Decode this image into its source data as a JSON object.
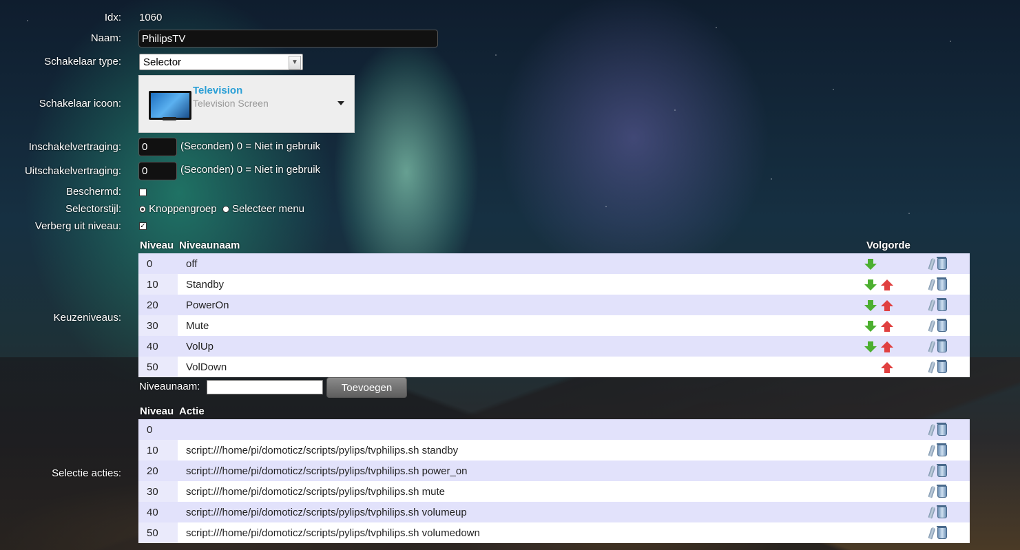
{
  "form": {
    "idx_label": "Idx:",
    "idx_value": "1060",
    "name_label": "Naam:",
    "name_value": "PhilipsTV",
    "switch_type_label": "Schakelaar type:",
    "switch_type_value": "Selector",
    "switch_icon_label": "Schakelaar icoon:",
    "icon_title": "Television",
    "icon_subtitle": "Television Screen",
    "on_delay_label": "Inschakelvertraging:",
    "on_delay_value": "0",
    "off_delay_label": "Uitschakelvertraging:",
    "off_delay_value": "0",
    "delay_hint": "(Seconden) 0 = Niet in gebruik",
    "protected_label": "Beschermd:",
    "protected_checked": false,
    "selector_style_label": "Selectorstijl:",
    "style_option_buttons": "Knoppengroep",
    "style_option_menu": "Selecteer menu",
    "style_selected": "Knoppengroep",
    "hide_off_label": "Verberg uit niveau:",
    "hide_off_checked": true,
    "check_mark": "✓"
  },
  "levels": {
    "section_label": "Keuzeniveaus:",
    "col_level": "Niveau",
    "col_name": "Niveaunaam",
    "col_order": "Volgorde",
    "rows": [
      {
        "level": "0",
        "name": "off",
        "down": true,
        "up": false
      },
      {
        "level": "10",
        "name": "Standby",
        "down": true,
        "up": true
      },
      {
        "level": "20",
        "name": "PowerOn",
        "down": true,
        "up": true
      },
      {
        "level": "30",
        "name": "Mute",
        "down": true,
        "up": true
      },
      {
        "level": "40",
        "name": "VolUp",
        "down": true,
        "up": true
      },
      {
        "level": "50",
        "name": "VolDown",
        "down": false,
        "up": true
      }
    ],
    "new_level_label": "Niveaunaam:",
    "new_level_value": "",
    "add_button": "Toevoegen"
  },
  "actions": {
    "section_label": "Selectie acties:",
    "col_level": "Niveau",
    "col_action": "Actie",
    "rows": [
      {
        "level": "0",
        "action": ""
      },
      {
        "level": "10",
        "action": "script:///home/pi/domoticz/scripts/pylips/tvphilips.sh standby"
      },
      {
        "level": "20",
        "action": "script:///home/pi/domoticz/scripts/pylips/tvphilips.sh power_on"
      },
      {
        "level": "30",
        "action": "script:///home/pi/domoticz/scripts/pylips/tvphilips.sh mute"
      },
      {
        "level": "40",
        "action": "script:///home/pi/domoticz/scripts/pylips/tvphilips.sh volumeup"
      },
      {
        "level": "50",
        "action": "script:///home/pi/domoticz/scripts/pylips/tvphilips.sh volumedown"
      }
    ]
  }
}
